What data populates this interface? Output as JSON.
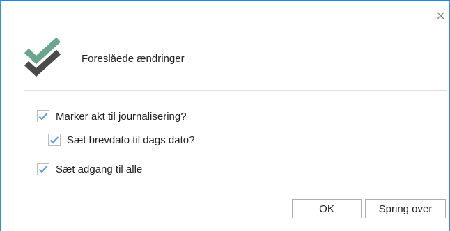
{
  "dialog": {
    "title": "Foreslåede ændringer",
    "close_icon": "close-icon",
    "header_icon": "double-checkmark-icon",
    "accent_color": "#5aa0e0",
    "icon_colors": {
      "top_check": "#6aa58f",
      "bottom_check": "#4a4a4a"
    }
  },
  "options": [
    {
      "label": "Marker akt til journalisering?",
      "checked": true
    },
    {
      "label": "Sæt brevdato til dags dato?",
      "checked": true
    },
    {
      "label": "Sæt adgang til alle",
      "checked": true
    }
  ],
  "buttons": {
    "ok_label": "OK",
    "skip_label": "Spring over"
  }
}
